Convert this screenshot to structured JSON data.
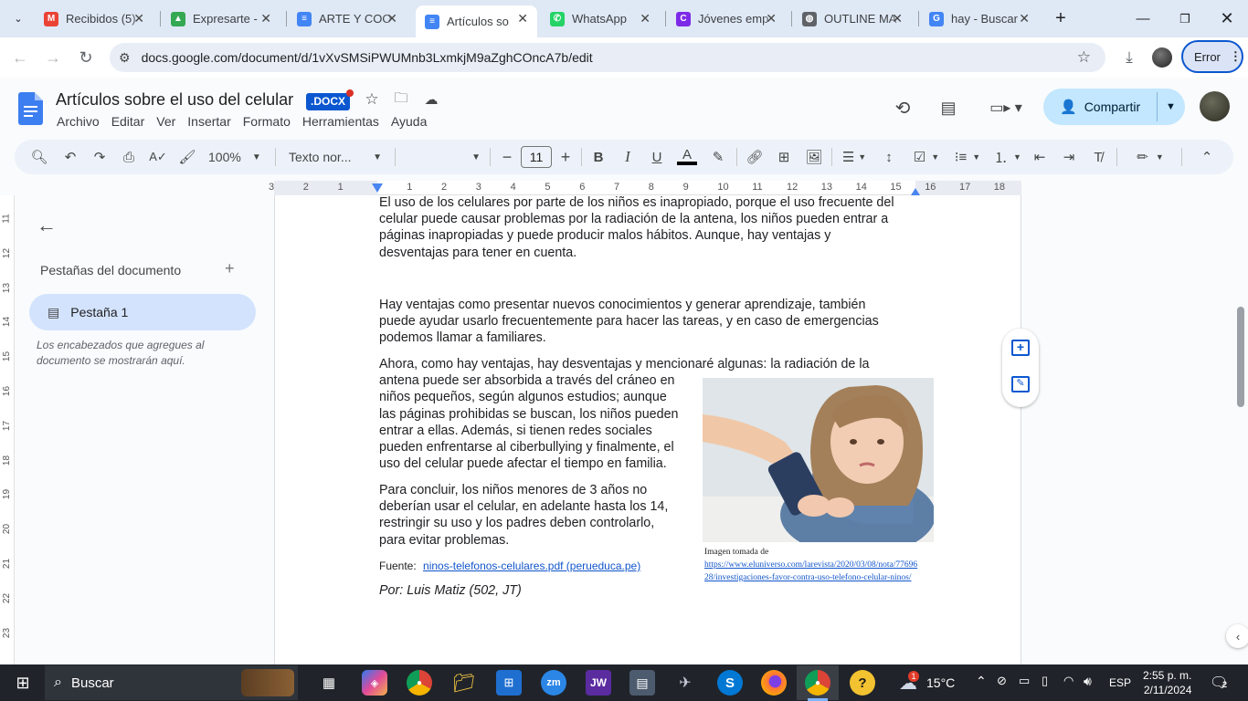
{
  "browser": {
    "tabs": [
      {
        "title": "Recibidos (5)",
        "icon": "gmail-icon",
        "color": "#ea4335",
        "glyph": "M"
      },
      {
        "title": "Expresarte -",
        "icon": "drive-icon",
        "color": "#34a853",
        "glyph": "▲"
      },
      {
        "title": "ARTE Y COO",
        "icon": "docs-icon",
        "color": "#4285f4",
        "glyph": "≡"
      },
      {
        "title": "Artículos so",
        "icon": "docs-icon",
        "color": "#4285f4",
        "glyph": "≡"
      },
      {
        "title": "WhatsApp",
        "icon": "whatsapp-icon",
        "color": "#25d366",
        "glyph": "✆"
      },
      {
        "title": "Jóvenes emp",
        "icon": "canva-icon",
        "color": "#7d2ae8",
        "glyph": "C"
      },
      {
        "title": "OUTLINE MA",
        "icon": "globe-icon",
        "color": "#5f6368",
        "glyph": "◍"
      },
      {
        "title": "hay - Buscar",
        "icon": "google-icon",
        "color": "#4285f4",
        "glyph": "G"
      }
    ],
    "new_tab": "+",
    "url": "docs.google.com/document/d/1vXvSMSiPWUMnb3LxmkjM9aZghCOncA7b/edit",
    "error_label": "Error"
  },
  "doc": {
    "title": "Artículos sobre el uso del celular",
    "badge": ".DOCX",
    "menu": [
      "Archivo",
      "Editar",
      "Ver",
      "Insertar",
      "Formato",
      "Herramientas",
      "Ayuda"
    ],
    "share_label": "Compartir"
  },
  "toolbar": {
    "zoom": "100%",
    "style": "Texto nor...",
    "font_size": "11"
  },
  "ruler": {
    "labels": [
      "3",
      "2",
      "1",
      "1",
      "2",
      "3",
      "4",
      "5",
      "6",
      "7",
      "8",
      "9",
      "10",
      "11",
      "12",
      "13",
      "14",
      "15",
      "16",
      "17",
      "18"
    ],
    "vlabels": [
      "11",
      "12",
      "13",
      "14",
      "15",
      "16",
      "17",
      "18",
      "19",
      "20",
      "21",
      "22",
      "23"
    ]
  },
  "sidebar": {
    "heading": "Pestañas del documento",
    "tab_label": "Pestaña 1",
    "hint_line1": "Los encabezados que agregues al",
    "hint_line2": "documento se mostrarán aquí."
  },
  "content": {
    "p1": [
      "El uso de los celulares por parte de los niños es inapropiado, porque el uso frecuente del",
      "celular puede causar problemas por la radiación de la antena, los niños pueden entrar a",
      "páginas inapropiadas y puede producir malos hábitos. Aunque, hay ventajas y",
      "desventajas para tener en cuenta."
    ],
    "p2": [
      "Hay ventajas como presentar nuevos conocimientos y generar aprendizaje, también",
      "puede ayudar usarlo frecuentemente para hacer las tareas, y en caso de emergencias",
      "podemos llamar a familiares."
    ],
    "p3": [
      "Ahora, como hay ventajas, hay  desventajas y mencionaré algunas: la radiación de la",
      "antena puede ser absorbida a través del cráneo en",
      "niños pequeños, según algunos estudios; aunque",
      "las páginas prohibidas se buscan, los niños pueden",
      "entrar a ellas. Además, si tienen redes sociales",
      "pueden enfrentarse al ciberbullying y finalmente, el",
      "uso del celular puede afectar el tiempo en familia."
    ],
    "p4": [
      "Para concluir, los niños menores de 3 años no",
      "deberían usar el celular, en adelante hasta los 14,",
      "restringir su uso y los padres deben controlarlo,",
      "para evitar problemas."
    ],
    "source_label": "Fuente:",
    "source_link": "ninos-telefonos-celulares.pdf (perueduca.pe)",
    "author": "Por: Luis Matiz (502, JT)",
    "caption_label": "Imagen tomada de",
    "caption_url1": "https://www.eluniverso.com/larevista/2020/03/08/nota/77696",
    "caption_url2": "28/investigaciones-favor-contra-uso-telefono-celular-ninos/"
  },
  "taskbar": {
    "search": "Buscar",
    "temperature": "15°C",
    "language": "ESP",
    "time": "2:55 p. m.",
    "date": "2/11/2024",
    "weather_badge": "1",
    "notif_count": "2"
  }
}
